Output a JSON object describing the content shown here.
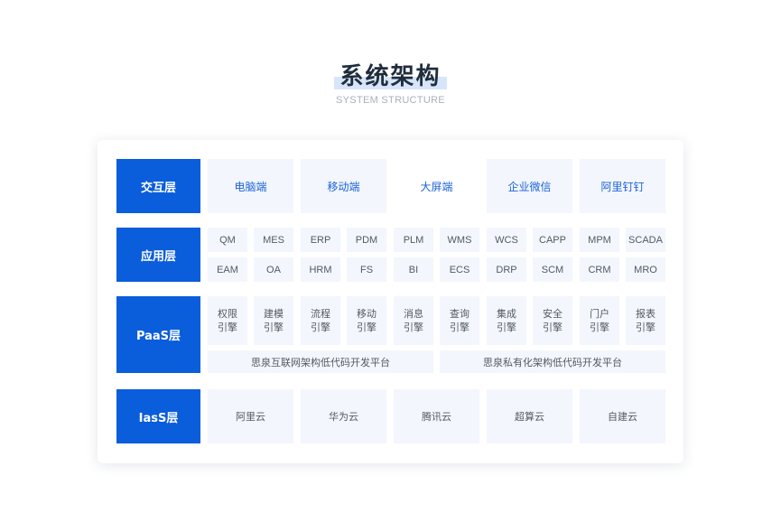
{
  "header": {
    "title": "系统架构",
    "subtitle": "SYSTEM STRUCTURE"
  },
  "layers": {
    "interaction": {
      "label": "交互层",
      "items": [
        "电脑端",
        "移动端",
        "大屏端",
        "企业微信",
        "阿里钉钉"
      ]
    },
    "application": {
      "label": "应用层",
      "row1": [
        "QM",
        "MES",
        "ERP",
        "PDM",
        "PLM",
        "WMS",
        "WCS",
        "CAPP",
        "MPM",
        "SCADA"
      ],
      "row2": [
        "EAM",
        "OA",
        "HRM",
        "FS",
        "BI",
        "ECS",
        "DRP",
        "SCM",
        "CRM",
        "MRO"
      ]
    },
    "paas": {
      "label": "PaaS层",
      "engines": [
        [
          "权限",
          "引擎"
        ],
        [
          "建模",
          "引擎"
        ],
        [
          "流程",
          "引擎"
        ],
        [
          "移动",
          "引擎"
        ],
        [
          "消息",
          "引擎"
        ],
        [
          "查询",
          "引擎"
        ],
        [
          "集成",
          "引擎"
        ],
        [
          "安全",
          "引擎"
        ],
        [
          "门户",
          "引擎"
        ],
        [
          "报表",
          "引擎"
        ]
      ],
      "platforms": [
        "思泉互联网架构低代码开发平台",
        "思泉私有化架构低代码开发平台"
      ]
    },
    "iaas": {
      "label": "IasS层",
      "items": [
        "阿里云",
        "华为云",
        "腾讯云",
        "超算云",
        "自建云"
      ]
    }
  },
  "colors": {
    "accent": "#0a5ddb",
    "cell_bg": "#f3f6fd",
    "link_text": "#1b63d8",
    "title_highlight": "#d7e5fb"
  }
}
